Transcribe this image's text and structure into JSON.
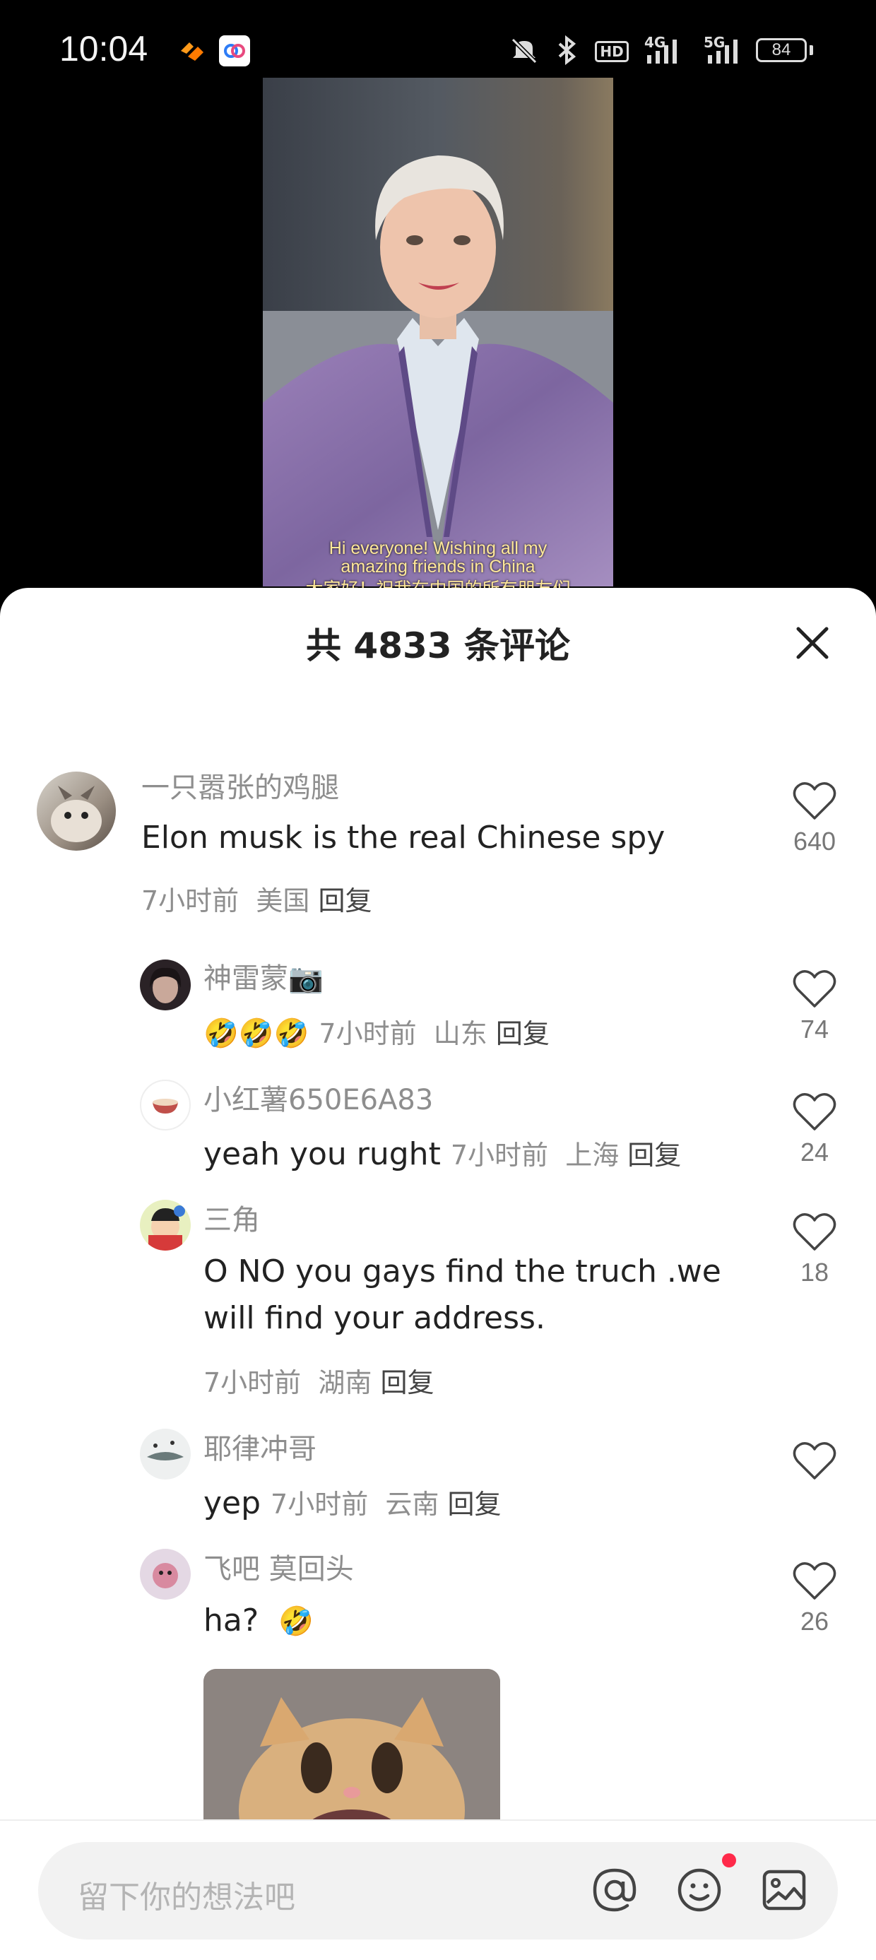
{
  "status_bar": {
    "time": "10:04",
    "battery": "84",
    "network_hd": "HD",
    "network_4g": "4G",
    "network_5g": "5G"
  },
  "video": {
    "subtitle_line1": "Hi everyone! Wishing all my",
    "subtitle_line2": "amazing friends in China",
    "subtitle_line3": "大家好！祝我在中国的所有朋友们"
  },
  "comments_sheet": {
    "title": "共 4833 条评论",
    "close_icon": "close-icon"
  },
  "comments": [
    {
      "username": "一只嚣张的鸡腿",
      "text": "Elon musk is the real Chinese spy",
      "time": "7小时前",
      "location": "美国",
      "reply": "回复",
      "likes": "640"
    },
    {
      "username": "神雷蒙📷",
      "emoji": "🤣🤣🤣",
      "time": "7小时前",
      "location": "山东",
      "reply": "回复",
      "likes": "74"
    },
    {
      "username": "小红薯650E6A83",
      "text": "yeah you rught",
      "time": "7小时前",
      "location": "上海",
      "reply": "回复",
      "likes": "24"
    },
    {
      "username": "三角",
      "text_line1": "O NO you gays find the truch .we",
      "text_line2": "will find your address.",
      "time": "7小时前",
      "location": "湖南",
      "reply": "回复",
      "likes": "18"
    },
    {
      "username": "耶律冲哥",
      "text": "yep",
      "time": "7小时前",
      "location": "云南",
      "reply": "回复",
      "likes": ""
    },
    {
      "username": "飞吧 莫回头",
      "text": "ha?",
      "emoji": "🤣",
      "likes": "26"
    }
  ],
  "input_bar": {
    "placeholder": "留下你的想法吧",
    "icons": [
      "at-icon",
      "emoji-icon",
      "image-icon"
    ]
  },
  "colors": {
    "sheet_bg": "#ffffff",
    "muted_text": "#8e8e8e",
    "main_text": "#222222",
    "notification_dot": "#ff2a4a"
  }
}
